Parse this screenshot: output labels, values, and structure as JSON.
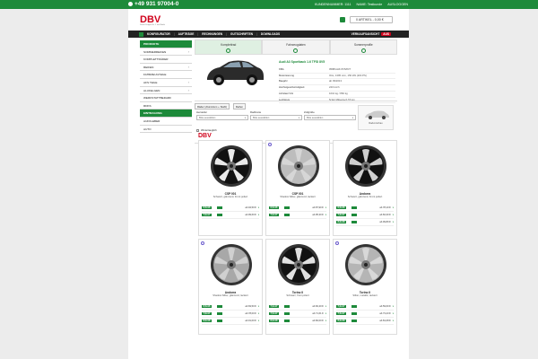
{
  "topbar": {
    "phone": "+49 931 97004-0",
    "customer_no": "KUNDENNUMMER: 1111",
    "name": "NAME: Testkunde",
    "logout": "AUSLOGGEN"
  },
  "header": {
    "logo": "DBV",
    "logo_sub": "Deine Felgen Nr. 1 am Markt",
    "cart": "0 ARTIKEL - 0,00 €"
  },
  "nav": {
    "items": [
      "KONFIGURATOR",
      "AUFTRÄGE",
      "RECHNUNGEN",
      "GUTSCHRIFTEN",
      "DOWNLOADS"
    ],
    "vk_label": "VERKAUFSANSICHT",
    "vk_badge": "AUS"
  },
  "sidebar": {
    "heading": "PRODUKTE",
    "items": [
      {
        "label": "SOMMERREIFEN",
        "chev": true
      },
      {
        "label": "KOMPLETTRÄDER",
        "chev": false
      },
      {
        "label": "REIFEN",
        "chev": true
      },
      {
        "label": "FAHRZEUGTEILE",
        "chev": false
      },
      {
        "label": "AFS TEILE",
        "chev": true
      },
      {
        "label": "ALUFELGEN",
        "chev": true
      },
      {
        "label": "WERKSTATTBEDARF",
        "chev": false
      },
      {
        "label": "RDKS",
        "chev": false
      },
      {
        "label": "EINTRAGUNG",
        "chev": false,
        "active": true
      },
      {
        "label": "AUFKLEBER",
        "chev": false
      },
      {
        "label": "AUTO",
        "chev": false
      }
    ]
  },
  "tabs": [
    {
      "label": "Komplettrad",
      "active": true
    },
    {
      "label": "Fahrzeugdaten",
      "active": false
    },
    {
      "label": "Sommerprofile",
      "active": false
    }
  ],
  "vehicle": {
    "title": "Audi A3 Sportback 1.6 TFSI 8V5",
    "specs": [
      {
        "k": "KBA",
        "v": "0588/AHK 8V5/8V7"
      },
      {
        "k": "Motorisierung",
        "v": "Otto, 1395 ccm, 150 kW (204 PS)"
      },
      {
        "k": "Baujahr",
        "v": "ab 09/2013"
      },
      {
        "k": "Höchstgeschwindigkeit",
        "v": "240 km/h"
      },
      {
        "k": "Achslast V/H",
        "v": "1010 kg / 860 kg"
      },
      {
        "k": "Lochkreis",
        "v": "5/112 Mittenloch 57mm"
      }
    ]
  },
  "filters": {
    "radio_a": "Räder (Aluminium + Stahl)",
    "radio_b": "Reifen",
    "groups": [
      {
        "label": "Hersteller",
        "value": "Bitte auswählen"
      },
      {
        "label": "Radbreite",
        "value": "Bitte auswählen"
      },
      {
        "label": "Zollgröße",
        "value": "Bitte auswählen"
      }
    ],
    "winter": "Wintertauglich",
    "preview": "Radvorschau"
  },
  "brand": "DBV",
  "products": [
    {
      "name": "CSP 001",
      "color": "Schwarz, glänzend, Front poliert",
      "new": false,
      "sizes": [
        {
          "size": "6,5x16",
          "price": "ab 94,50 €"
        },
        {
          "size": "7,0x17",
          "price": "ab 99,60 €"
        }
      ]
    },
    {
      "name": "CSP 001",
      "color": "Shadow Silber, glänzend, lackiert",
      "new": true,
      "sizes": [
        {
          "size": "6,5x16",
          "price": "ab 87,90 €"
        },
        {
          "size": "7,0x17",
          "price": "ab 95,30 €"
        }
      ]
    },
    {
      "name": "Andorra",
      "color": "Schwarz, glänzend, Front poliert",
      "new": false,
      "sizes": [
        {
          "size": "6,5x16",
          "price": "ab 78,10 €"
        },
        {
          "size": "7,0x17",
          "price": "ab 84,30 €"
        },
        {
          "size": "8,0x18",
          "price": "ab 99,80 €"
        }
      ]
    },
    {
      "name": "Andorra",
      "color": "Shadow Silber, glänzend, lackiert",
      "new": true,
      "sizes": [
        {
          "size": "6,5x16",
          "price": "ab 69,50 €"
        },
        {
          "size": "7,0x17",
          "price": "ab 78,00 €"
        },
        {
          "size": "8,0x18",
          "price": "ab 91,00 €"
        }
      ]
    },
    {
      "name": "Torino II",
      "color": "Schwarz, front poliert",
      "new": false,
      "sizes": [
        {
          "size": "7,0x17",
          "price": "ab 66,40 €"
        },
        {
          "size": "7,5x17",
          "price": "ab 71,61 €"
        },
        {
          "size": "8,0x18",
          "price": "ab 82,00 €"
        }
      ]
    },
    {
      "name": "Torino II",
      "color": "Silber, metallic, lackiert",
      "new": true,
      "sizes": [
        {
          "size": "7,0x17",
          "price": "ab 59,60 €"
        },
        {
          "size": "7,5x17",
          "price": "ab 73,43 €"
        },
        {
          "size": "8,0x18",
          "price": "ab 81,08 €"
        }
      ]
    }
  ],
  "colors": {
    "accent": "#1d8a3a",
    "brand": "#d0021b",
    "nav": "#222222"
  }
}
